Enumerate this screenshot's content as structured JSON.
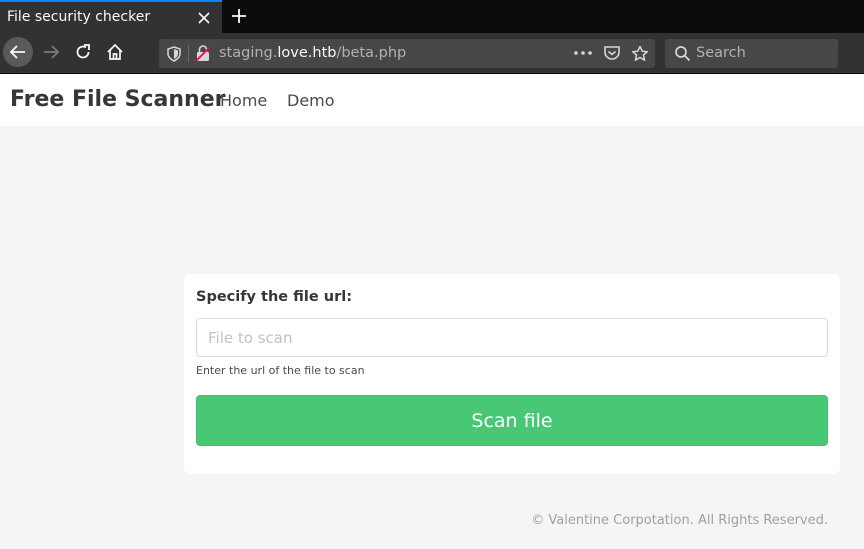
{
  "browser": {
    "tab_title": "File security checker",
    "url_prefix": "staging.",
    "url_host": "love.htb",
    "url_path": "/beta.php",
    "search_placeholder": "Search"
  },
  "site": {
    "brand": "Free File Scanner",
    "nav": {
      "home": "Home",
      "demo": "Demo"
    }
  },
  "form": {
    "label": "Specify the file url:",
    "input_placeholder": "File to scan",
    "input_value": "",
    "help": "Enter the url of the file to scan",
    "submit_label": "Scan file"
  },
  "footer": {
    "text": "© Valentine Corpotation. All Rights Reserved."
  },
  "colors": {
    "accent": "#48c774",
    "tab_highlight": "#0a84ff"
  }
}
